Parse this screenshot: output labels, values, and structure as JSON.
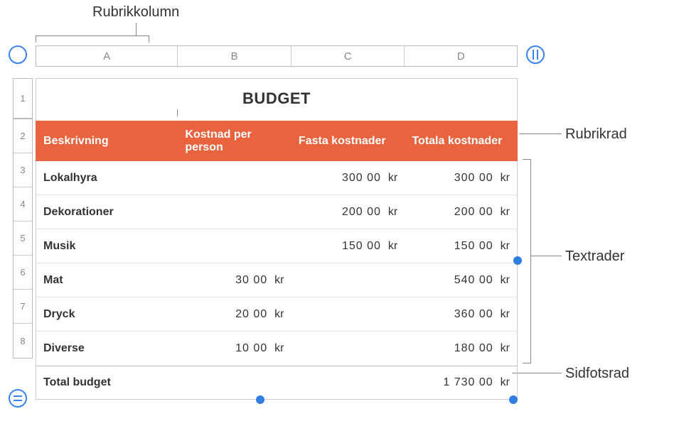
{
  "callouts": {
    "rubrikkolumn": "Rubrikkolumn",
    "rubrikrad": "Rubrikrad",
    "textrader": "Textrader",
    "sidfotsrad": "Sidfotsrad"
  },
  "columns": {
    "A": "A",
    "B": "B",
    "C": "C",
    "D": "D"
  },
  "row_labels": [
    "1",
    "2",
    "3",
    "4",
    "5",
    "6",
    "7",
    "8"
  ],
  "table": {
    "title": "BUDGET",
    "currency": "kr",
    "headers": {
      "desc": "Beskrivning",
      "per_person": "Kostnad per person",
      "fixed": "Fasta kostnader",
      "total": "Totala kostnader"
    },
    "rows": [
      {
        "desc": "Lokalhyra",
        "per_person": "",
        "fixed": "300 00",
        "total": "300 00"
      },
      {
        "desc": "Dekorationer",
        "per_person": "",
        "fixed": "200 00",
        "total": "200 00"
      },
      {
        "desc": "Musik",
        "per_person": "",
        "fixed": "150 00",
        "total": "150 00"
      },
      {
        "desc": "Mat",
        "per_person": "30 00",
        "fixed": "",
        "total": "540 00"
      },
      {
        "desc": "Dryck",
        "per_person": "20 00",
        "fixed": "",
        "total": "360 00"
      },
      {
        "desc": "Diverse",
        "per_person": "10 00",
        "fixed": "",
        "total": "180 00"
      }
    ],
    "footer": {
      "desc": "Total budget",
      "total": "1 730 00"
    }
  }
}
